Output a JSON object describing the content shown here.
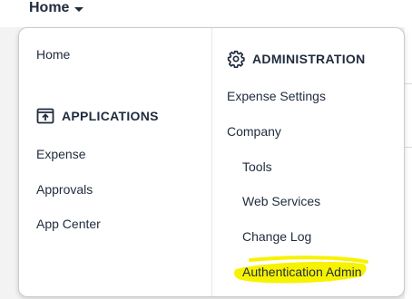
{
  "top_nav": {
    "label": "Home"
  },
  "menu": {
    "left_column": {
      "home": "Home",
      "applications_heading": "APPLICATIONS",
      "items": [
        "Expense",
        "Approvals",
        "App Center"
      ]
    },
    "right_column": {
      "administration_heading": "ADMINISTRATION",
      "items": [
        "Expense Settings",
        "Company"
      ],
      "sub_items": [
        "Tools",
        "Web Services",
        "Change Log",
        "Authentication Admin"
      ]
    }
  },
  "icons": {
    "top_nav": "caret-down-icon",
    "applications": "app-upload-icon",
    "administration": "gear-icon"
  },
  "colors": {
    "text": "#1f2b3d",
    "highlight": "#f7f200",
    "border": "#c6ccd3",
    "backdrop": "#f3f3f3"
  }
}
